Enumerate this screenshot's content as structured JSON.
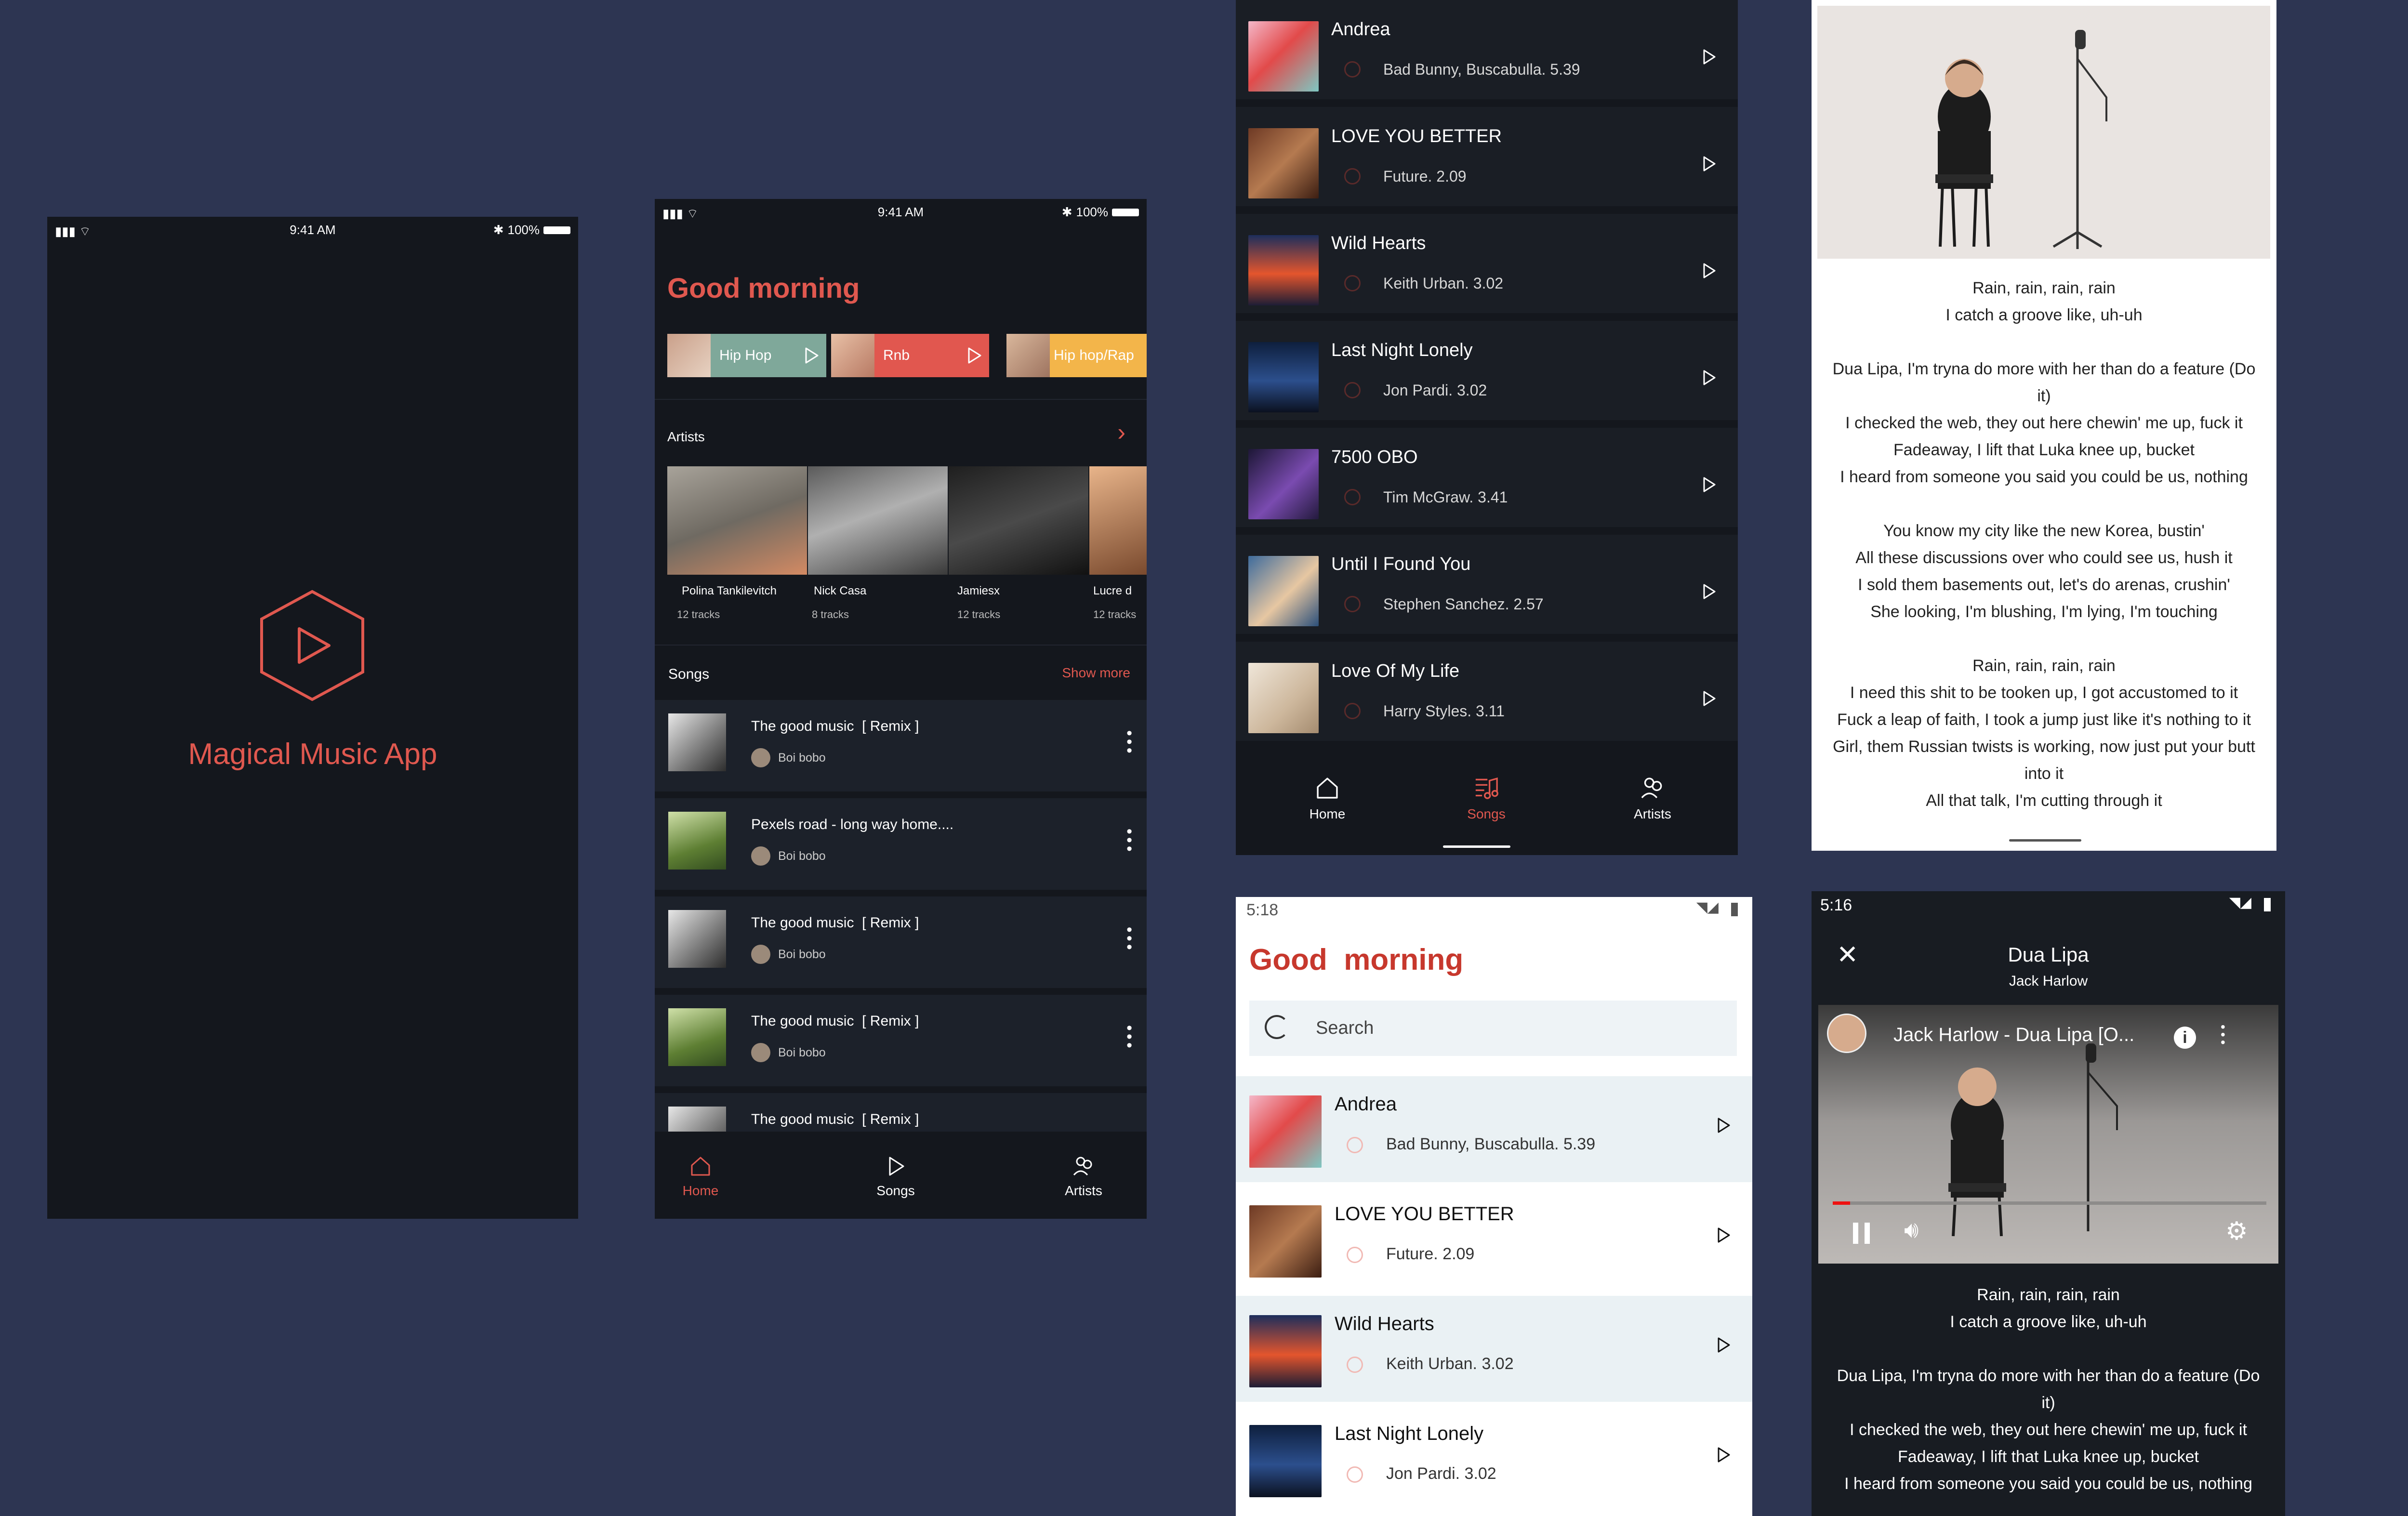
{
  "splash": {
    "status_time": "9:41 AM",
    "status_battery": "100%",
    "app_name": "Magical Music App"
  },
  "home_dark": {
    "status_time": "9:41 AM",
    "status_battery": "100%",
    "greeting": "Good morning",
    "genres": [
      {
        "label": "Hip Hop",
        "color": "#7fa89a"
      },
      {
        "label": "Rnb",
        "color": "#e1574f"
      },
      {
        "label": "Hip hop/Rap",
        "color": "#f3b54a"
      }
    ],
    "artists_heading": "Artists",
    "artists": [
      {
        "name": "Polina Tankilevitch",
        "tracks": "12 tracks"
      },
      {
        "name": "Nick Casa",
        "tracks": "8 tracks"
      },
      {
        "name": "Jamiesx",
        "tracks": "12 tracks"
      },
      {
        "name": "Lucre d",
        "tracks": "12 tracks"
      }
    ],
    "songs_heading": "Songs",
    "show_more": "Show more",
    "songs": [
      {
        "title": "The good music  [ Remix ]",
        "artist": "Boi bobo"
      },
      {
        "title": "Pexels road - long way home....",
        "artist": "Boi bobo"
      },
      {
        "title": "The good music  [ Remix ]",
        "artist": "Boi bobo"
      },
      {
        "title": "The good music  [ Remix ]",
        "artist": "Boi bobo"
      },
      {
        "title": "The good music  [ Remix ]",
        "artist": ""
      }
    ],
    "nav": {
      "home": "Home",
      "songs": "Songs",
      "artists": "Artists"
    }
  },
  "songs_dark": {
    "songs": [
      {
        "title": "Andrea",
        "meta": "Bad Bunny, Buscabulla. 5.39"
      },
      {
        "title": "LOVE YOU BETTER",
        "meta": "Future. 2.09"
      },
      {
        "title": "Wild Hearts",
        "meta": "Keith Urban. 3.02"
      },
      {
        "title": "Last Night Lonely",
        "meta": "Jon Pardi. 3.02"
      },
      {
        "title": "7500 OBO",
        "meta": "Tim McGraw. 3.41"
      },
      {
        "title": "Until I Found You",
        "meta": "Stephen Sanchez. 2.57"
      },
      {
        "title": "Love Of My Life",
        "meta": "Harry Styles. 3.11"
      }
    ],
    "nav": {
      "home": "Home",
      "songs": "Songs",
      "artists": "Artists"
    }
  },
  "lyrics_light": {
    "lines": [
      "Rain, rain, rain, rain",
      "I catch a groove like, uh-uh",
      "",
      "Dua Lipa, I'm tryna do more with her than do a feature (Do",
      "it)",
      "I checked the web, they out here chewin' me up, fuck it",
      "Fadeaway, I lift that Luka knee up, bucket",
      "I heard from someone you said you could be us, nothing",
      "",
      "You know my city like the new Korea, bustin'",
      "All these discussions over who could see us, hush it",
      "I sold them basements out, let's do arenas, crushin'",
      "She looking, I'm blushing, I'm lying, I'm touching",
      "",
      "Rain, rain, rain, rain",
      "I need this shit to be tooken up, I got accustomed to it",
      "Fuck a leap of faith, I took a jump just like it's nothing to it",
      "Girl, them Russian twists is working, now just put your butt",
      "into it",
      "All that talk, I'm cutting through it"
    ]
  },
  "home_light": {
    "status_time": "5:18",
    "greeting_word1": "Good",
    "greeting_word2": "morning",
    "search_placeholder": "Search",
    "songs": [
      {
        "title": "Andrea",
        "meta": "Bad Bunny, Buscabulla. 5.39"
      },
      {
        "title": "LOVE YOU BETTER",
        "meta": "Future. 2.09"
      },
      {
        "title": "Wild Hearts",
        "meta": "Keith Urban. 3.02"
      },
      {
        "title": "Last Night Lonely",
        "meta": "Jon Pardi. 3.02"
      }
    ]
  },
  "player_dark": {
    "status_time": "5:16",
    "song_title": "Dua Lipa",
    "artist": "Jack Harlow",
    "video_title": "Jack Harlow - Dua Lipa [O...",
    "video_progress_pct": 4,
    "lines": [
      "Rain, rain, rain, rain",
      "I catch a groove like, uh-uh",
      "",
      "Dua Lipa, I'm tryna do more with her than do a feature (Do",
      "it)",
      "I checked the web, they out here chewin' me up, fuck it",
      "Fadeaway, I lift that Luka knee up, bucket",
      "I heard from someone you said you could be us, nothing"
    ]
  }
}
